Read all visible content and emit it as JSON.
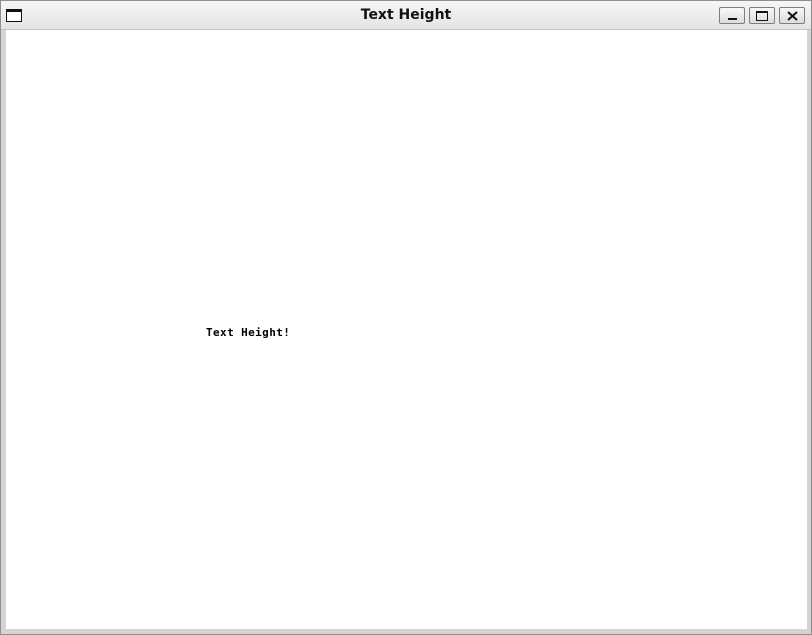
{
  "window": {
    "title": "Text Height",
    "controls": {
      "minimize_icon": "minimize-icon",
      "maximize_icon": "maximize-icon",
      "close_icon": "close-icon"
    }
  },
  "canvas": {
    "text": "Text Height!"
  },
  "colors": {
    "titlebar": "#eeeeee",
    "client_background": "#ffffff",
    "frame": "#d4d4d4",
    "text": "#000000"
  }
}
